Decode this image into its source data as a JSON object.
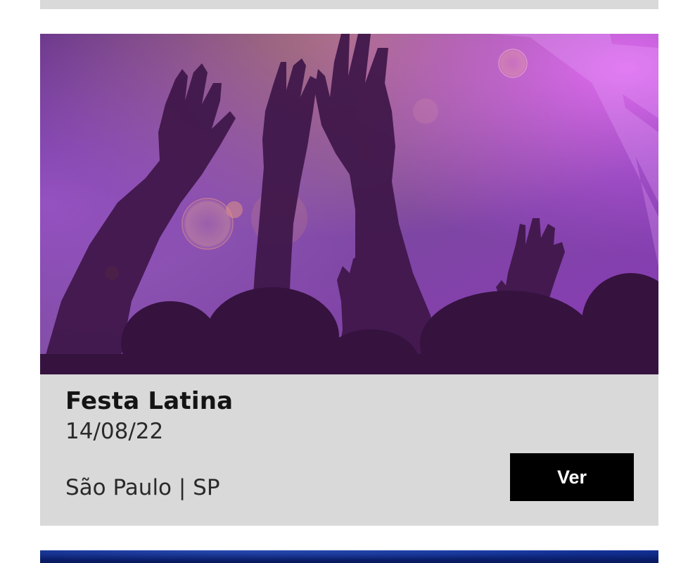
{
  "event": {
    "title": "Festa Latina",
    "date": "14/08/22",
    "location": "São Paulo | SP",
    "button_label": "Ver",
    "image_description_icon": "concert-crowd-image"
  },
  "colors": {
    "card_background": "#d9d9d9",
    "button_background": "#000000",
    "button_text": "#ffffff",
    "image_tint": "#7a2fb0",
    "next_card_tint": "#0d2a8a"
  }
}
